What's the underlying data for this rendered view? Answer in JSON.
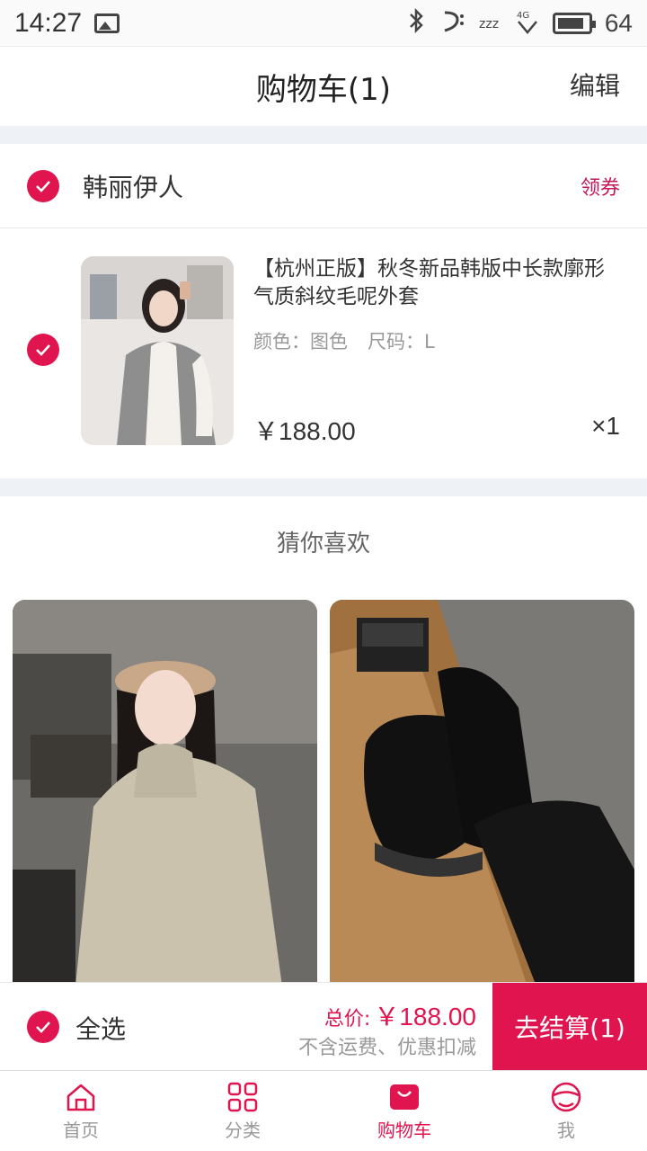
{
  "status_bar": {
    "time": "14:27",
    "battery": "64"
  },
  "header": {
    "title": "购物车(1)",
    "edit_label": "编辑"
  },
  "shop": {
    "name": "韩丽伊人",
    "coupon_label": "领券"
  },
  "cart_item": {
    "title": "【杭州正版】秋冬新品韩版中长款廓形气质斜纹毛呢外套",
    "color": "颜色：图色",
    "size": "尺码：L",
    "price": "￥188.00",
    "quantity": "×1"
  },
  "recommend": {
    "title": "猜你喜欢"
  },
  "summary": {
    "select_all_label": "全选",
    "total_label": "总价:",
    "total_value": "￥188.00",
    "note": "不含运费、优惠扣减",
    "checkout_label": "去结算(1)"
  },
  "tabs": [
    {
      "label": "首页",
      "icon": "home-icon"
    },
    {
      "label": "分类",
      "icon": "grid-icon"
    },
    {
      "label": "购物车",
      "icon": "cart-icon",
      "active": true
    },
    {
      "label": "我",
      "icon": "profile-icon"
    }
  ],
  "colors": {
    "accent": "#e0154f",
    "background_gap": "#eef2f6"
  }
}
